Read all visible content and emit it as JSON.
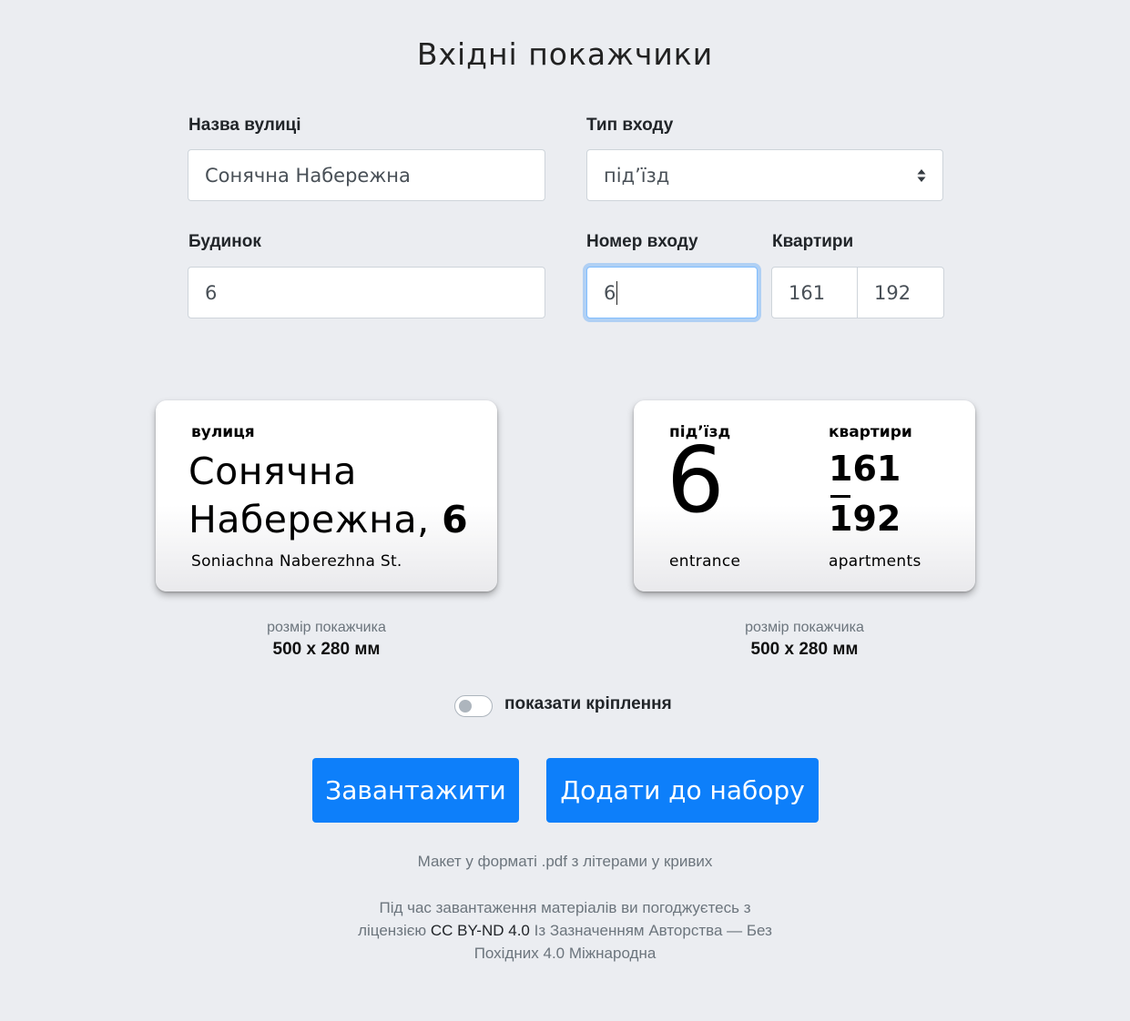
{
  "page": {
    "title": "Вхідні покажчики"
  },
  "form": {
    "street": {
      "label": "Назва вулиці",
      "value": "Сонячна Набережна"
    },
    "entrance_type": {
      "label": "Тип входу",
      "value": "під’їзд"
    },
    "house": {
      "label": "Будинок",
      "value": "6"
    },
    "entrance_number": {
      "label": "Номер входу",
      "value": "6"
    },
    "apartments": {
      "label": "Квартири",
      "from": "161",
      "to": "192"
    }
  },
  "plates": {
    "street": {
      "caption": "вулиця",
      "name_line1": "Сонячна",
      "name_line2": "Набережна,",
      "house": "6",
      "translit": "Soniachna Naberezhna St."
    },
    "entrance": {
      "caption_left": "під’їзд",
      "number": "6",
      "sub_left": "entrance",
      "caption_right": "квартири",
      "apt_from": "161",
      "apt_to": "192",
      "sub_right": "apartments"
    }
  },
  "sizes": [
    {
      "caption": "розмір покажчика",
      "value": "500 x 280 мм"
    },
    {
      "caption": "розмір покажчика",
      "value": "500 x 280 мм"
    }
  ],
  "toggle": {
    "label": "показати кріплення",
    "checked": false
  },
  "buttons": {
    "download": "Завантажити",
    "add": "Додати до набору"
  },
  "notes": {
    "format": "Макет у форматі .pdf з літерами у кривих",
    "license_line1": "Під час завантаження матеріалів ви погоджуєтесь з",
    "license_prefix": "ліцензією ",
    "license_code": "CC BY-ND 4.0",
    "license_mid": " Із ",
    "license_rest": "Зазначенням Авторства — Без",
    "license_line3": "Похідних 4.0 Міжнародна"
  },
  "colors": {
    "background": "#ebedf1",
    "primary": "#0d7ffa",
    "focus": "#80bdff"
  },
  "icons": {
    "select": "sort-arrows-icon",
    "toggle": "toggle-switch"
  }
}
